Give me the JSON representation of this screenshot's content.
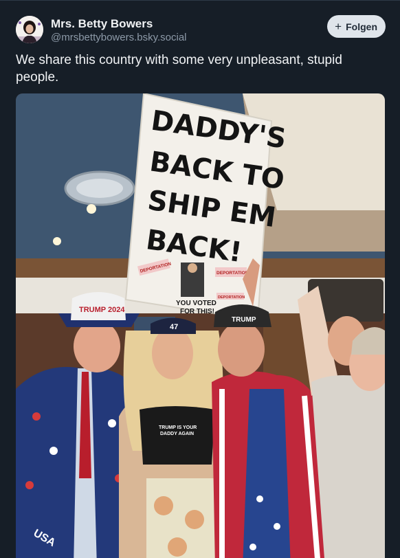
{
  "author": {
    "display_name": "Mrs. Betty Bowers",
    "handle": "@mrsbettybowers.bsky.social"
  },
  "follow_button": {
    "icon": "plus-icon",
    "label": "Folgen"
  },
  "post": {
    "text": "We share this country with some very unpleasant, stupid people."
  },
  "image": {
    "sign_lines": [
      "DADDY'S",
      "BACK TO",
      "SHIP EM",
      "BACK!"
    ],
    "sign_stickers": [
      "DEPORTATION",
      "DEPORTATION",
      "DEPORTATION"
    ],
    "sign_caption_lines": [
      "YOU VOTED",
      "FOR THIS!"
    ],
    "hat_left": "TRUMP 2024",
    "hat_center": "47",
    "hat_right": "TRUMP",
    "shirt_lines": [
      "TRUMP IS YOUR",
      "DADDY AGAIN"
    ],
    "suit_text": "USA"
  },
  "colors": {
    "background": "#161e27",
    "text_primary": "#f1f3f5",
    "text_secondary": "#8d9aa8",
    "button_bg": "#dfe5eb",
    "button_text": "#1f2a36"
  }
}
